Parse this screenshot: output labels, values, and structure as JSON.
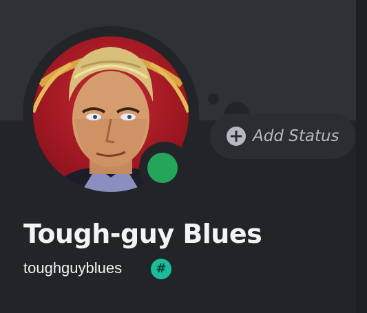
{
  "profile": {
    "display_name": "Tough-guy Blues",
    "username": "toughguyblues",
    "presence": "online",
    "status_button_label": "Add Status",
    "badge_glyph": "#"
  },
  "icons": {
    "status_button": "plus-circle-icon",
    "username_badge": "hashtag-badge-icon"
  },
  "colors": {
    "banner": "#303136",
    "card_background": "#232428",
    "online": "#23a55a",
    "badge": "#1abc9c",
    "text_primary": "#f2f3f5",
    "text_muted": "#b5bac1"
  }
}
